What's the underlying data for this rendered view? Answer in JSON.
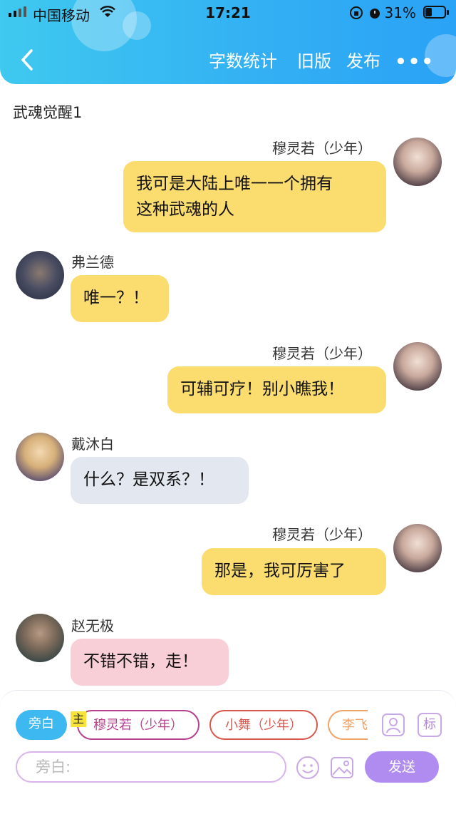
{
  "status_bar": {
    "carrier": "中国移动",
    "time": "17:21",
    "battery": "31%"
  },
  "nav": {
    "word_count": "字数统计",
    "old_version": "旧版",
    "publish": "发布",
    "more": "•••"
  },
  "scene_title": "武魂觉醒1",
  "messages": [
    {
      "speaker": "穆灵若（少年）",
      "text_line1": "我可是大陆上唯一一个拥有",
      "text_line2": "这种武魂的人",
      "side": "right"
    },
    {
      "speaker": "弗兰德",
      "text": "唯一？！",
      "side": "left"
    },
    {
      "speaker": "穆灵若（少年）",
      "text": "可辅可疗！别小瞧我！",
      "side": "right"
    },
    {
      "speaker": "戴沐白",
      "text": "什么？是双系？！",
      "side": "left"
    },
    {
      "speaker": "穆灵若（少年）",
      "text": "那是，我可厉害了",
      "side": "right"
    },
    {
      "speaker": "赵无极",
      "text": "不错不错，走！",
      "side": "left"
    }
  ],
  "compose": {
    "chips": [
      "旁白",
      "穆灵若（少年）",
      "小舞（少年）",
      "李飞"
    ],
    "main_badge": "主",
    "role_icon": "person-card-icon",
    "tag_label": "标",
    "input_placeholder": "旁白:",
    "emoji_icon": "emoji-icon",
    "image_icon": "image-icon",
    "send": "发送"
  },
  "colors": {
    "header": "#33b1f3",
    "bubble_right": "#fbdc6f",
    "bubble_gray": "#e3e7f0",
    "bubble_pink": "#f9cfd7",
    "send": "#b18cf0"
  }
}
